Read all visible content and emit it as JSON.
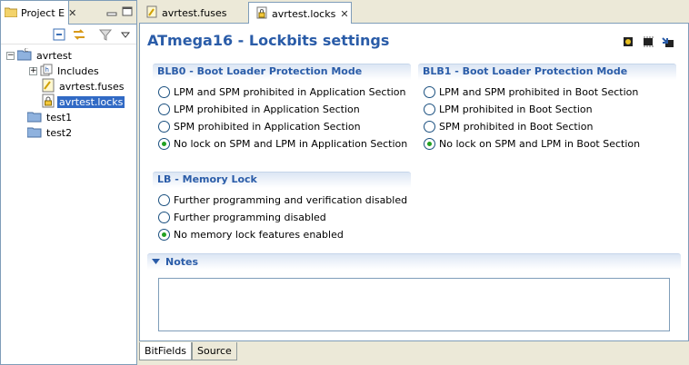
{
  "project_view": {
    "tab_title": "Project E",
    "tree": [
      {
        "label": "avrtest"
      },
      {
        "label": "Includes"
      },
      {
        "label": "avrtest.fuses"
      },
      {
        "label": "avrtest.locks"
      },
      {
        "label": "test1"
      },
      {
        "label": "test2"
      }
    ]
  },
  "editor": {
    "tabs": [
      {
        "label": "avrtest.fuses"
      },
      {
        "label": "avrtest.locks"
      }
    ],
    "title": "ATmega16 - Lockbits settings",
    "sections": {
      "blb0": {
        "title": "BLB0 - Boot Loader Protection Mode",
        "options": [
          "LPM and SPM prohibited in Application Section",
          "LPM prohibited in Application Section",
          "SPM prohibited in Application Section",
          "No lock on SPM and LPM in Application Section"
        ],
        "selected": 3
      },
      "blb1": {
        "title": "BLB1 - Boot Loader Protection Mode",
        "options": [
          "LPM and SPM prohibited in Boot Section",
          "LPM prohibited in Boot Section",
          "SPM prohibited in Boot Section",
          "No lock on SPM and LPM in Boot Section"
        ],
        "selected": 3
      },
      "lb": {
        "title": "LB - Memory Lock",
        "options": [
          "Further programming and verification disabled",
          "Further programming disabled",
          "No memory lock features enabled"
        ],
        "selected": 2
      }
    },
    "notes_title": "Notes",
    "bottom_tabs": [
      {
        "label": "BitFields"
      },
      {
        "label": "Source"
      }
    ]
  },
  "icons": {
    "close": "close-icon",
    "folder": "folder-icon",
    "project": "project-icon",
    "file_fuses": "fuses-file-icon",
    "file_locks": "lock-file-icon"
  },
  "colors": {
    "title": "#2a5ca8",
    "selection": "#316ac5",
    "radio_dot": "#21a121"
  }
}
